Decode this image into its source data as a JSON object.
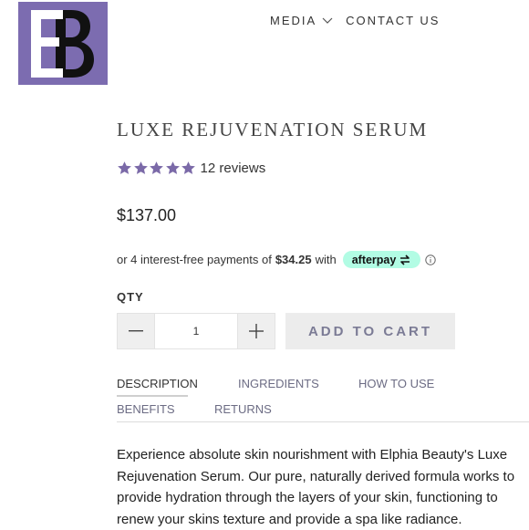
{
  "brand": {
    "logo_name": "Elphia Beauty",
    "logo_color": "#7c6cb0"
  },
  "nav": {
    "media_label": "MEDIA",
    "contact_label": "CONTACT US"
  },
  "product": {
    "title": "LUXE REJUVENATION SERUM",
    "rating": 5,
    "reviews_label": "12 reviews",
    "star_color": "#7b6aa8",
    "price": "$137.00",
    "installment_prefix": "or 4 interest-free payments of",
    "installment_amount": "$34.25",
    "installment_suffix": "with",
    "afterpay_label": "afterpay",
    "afterpay_color": "#b2fce4"
  },
  "qty": {
    "label": "QTY",
    "value": "1"
  },
  "cart": {
    "label": "ADD TO CART"
  },
  "tabs": [
    {
      "label": "DESCRIPTION",
      "active": true
    },
    {
      "label": "INGREDIENTS",
      "active": false
    },
    {
      "label": "HOW TO USE",
      "active": false
    },
    {
      "label": "BENEFITS",
      "active": false
    },
    {
      "label": "RETURNS",
      "active": false
    }
  ],
  "description": "Experience absolute skin nourishment with Elphia Beauty's Luxe Rejuvenation Serum. Our pure, naturally derived formula works to provide hydration through the layers of your skin, functioning to renew your skins texture and provide a spa like radiance."
}
